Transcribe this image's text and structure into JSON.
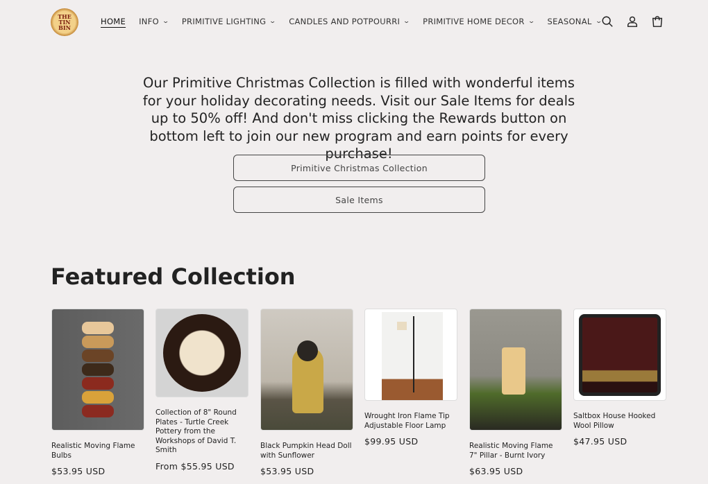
{
  "header": {
    "logo_text": "THE TIN BIN",
    "nav": [
      {
        "label": "HOME",
        "active": true,
        "dropdown": false
      },
      {
        "label": "INFO",
        "dropdown": true
      },
      {
        "label": "PRIMITIVE LIGHTING",
        "dropdown": true
      },
      {
        "label": "CANDLES AND POTPOURRI",
        "dropdown": true
      },
      {
        "label": "PRIMITIVE HOME DECOR",
        "dropdown": true
      },
      {
        "label": "SEASONAL",
        "dropdown": true
      }
    ],
    "icons": [
      "search-icon",
      "account-icon",
      "cart-icon"
    ]
  },
  "intro": "Our Primitive Christmas Collection is filled with wonderful items for your holiday decorating needs. Visit our Sale Items for deals up to 50% off! And don't miss clicking the Rewards button on bottom left to join our new program and earn points for every purchase!",
  "buttons": {
    "christmas": "Primitive Christmas Collection",
    "sale": "Sale Items"
  },
  "featured": {
    "heading": "Featured Collection",
    "products": [
      {
        "title": "Realistic Moving Flame Bulbs",
        "price": "$53.95 USD"
      },
      {
        "title": "Collection of 8\" Round Plates - Turtle Creek Pottery from the Workshops of David T. Smith",
        "price": "From $55.95 USD"
      },
      {
        "title": "Black Pumpkin Head Doll with Sunflower",
        "price": "$53.95 USD"
      },
      {
        "title": "Wrought Iron Flame Tip Adjustable Floor Lamp",
        "price": "$99.95 USD"
      },
      {
        "title": "Realistic Moving Flame 7\" Pillar - Burnt Ivory",
        "price": "$63.95 USD"
      },
      {
        "title": "Saltbox House Hooked Wool Pillow",
        "price": "$47.95 USD"
      }
    ]
  }
}
